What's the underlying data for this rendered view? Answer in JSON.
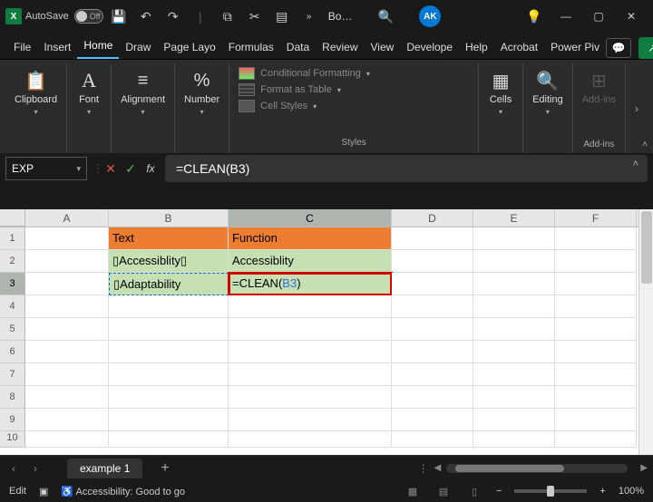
{
  "titlebar": {
    "autosave_label": "AutoSave",
    "autosave_state": "Off",
    "doc_title": "Bo…",
    "avatar": "AK"
  },
  "menu": {
    "items": [
      "File",
      "Insert",
      "Home",
      "Draw",
      "Page Layo",
      "Formulas",
      "Data",
      "Review",
      "View",
      "Develope",
      "Help",
      "Acrobat",
      "Power Piv"
    ],
    "active": "Home"
  },
  "ribbon": {
    "clipboard": "Clipboard",
    "font": "Font",
    "alignment": "Alignment",
    "number": "Number",
    "styles": {
      "cond_fmt": "Conditional Formatting",
      "as_table": "Format as Table",
      "cell_styles": "Cell Styles",
      "label": "Styles"
    },
    "cells": "Cells",
    "editing": "Editing",
    "addins": "Add-ins",
    "addins_label": "Add-ins"
  },
  "formula_bar": {
    "namebox": "EXP",
    "formula": "=CLEAN(B3)"
  },
  "grid": {
    "col_widths": {
      "A": 92,
      "B": 132,
      "C": 180,
      "D": 90,
      "E": 90,
      "F": 90
    },
    "columns": [
      "A",
      "B",
      "C",
      "D",
      "E",
      "F"
    ],
    "rows": [
      "1",
      "2",
      "3",
      "4",
      "5",
      "6",
      "7",
      "8",
      "9",
      "10"
    ],
    "active_col": "C",
    "active_row": "3",
    "cells": {
      "B1": "Text",
      "C1": "Function",
      "B2": "▯Accessiblity▯",
      "C2": "Accessiblity",
      "B3": "▯Adaptability",
      "C3_prefix": "=CLEAN(",
      "C3_arg": "B3",
      "C3_suffix": ")"
    }
  },
  "sheets": {
    "active": "example 1"
  },
  "status": {
    "mode": "Edit",
    "accessibility": "Accessibility: Good to go",
    "zoom": "100%"
  }
}
